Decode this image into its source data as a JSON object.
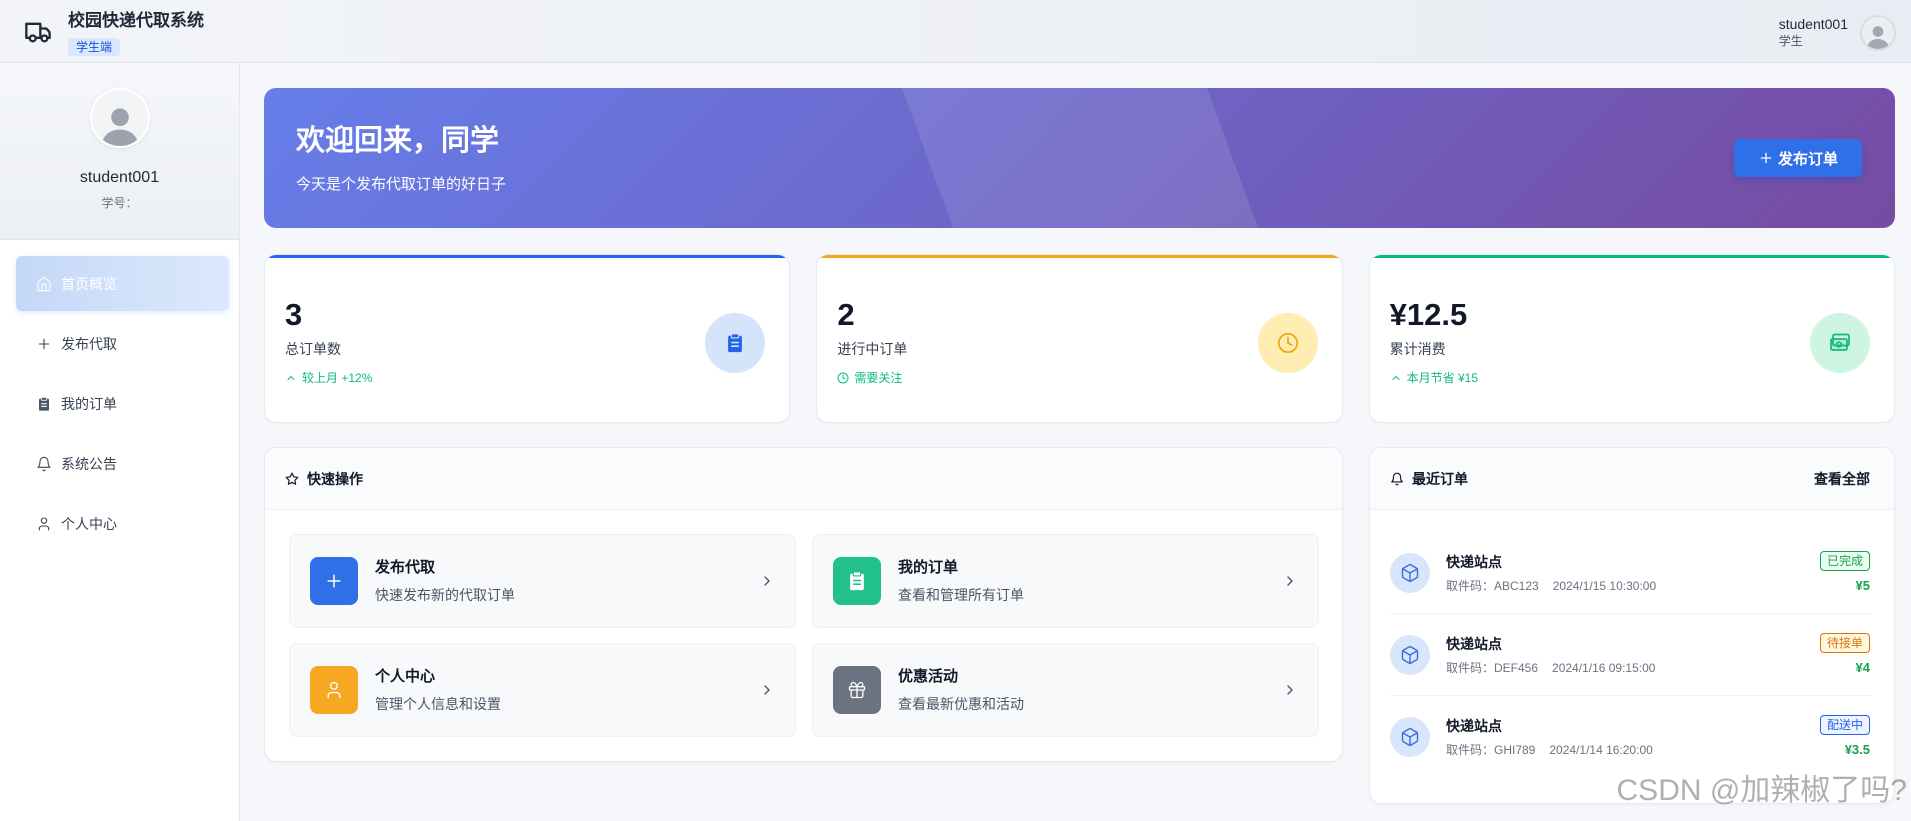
{
  "header": {
    "title": "校园快递代取系统",
    "badge": "学生端",
    "logo_icon": "truck-icon",
    "username": "student001",
    "role": "学生"
  },
  "sidebar": {
    "profile": {
      "name": "student001",
      "student_id_label": "学号："
    },
    "items": [
      {
        "label": "首页概览",
        "icon": "home-icon",
        "active": true
      },
      {
        "label": "发布代取",
        "icon": "plus-icon",
        "active": false
      },
      {
        "label": "我的订单",
        "icon": "clipboard-icon",
        "active": false
      },
      {
        "label": "系统公告",
        "icon": "bell-icon",
        "active": false
      },
      {
        "label": "个人中心",
        "icon": "user-icon",
        "active": false
      }
    ]
  },
  "banner": {
    "title": "欢迎回来，同学",
    "subtitle": "今天是个发布代取订单的好日子",
    "button_label": "发布订单",
    "button_icon": "plus-icon",
    "gradient_start": "#667eea",
    "gradient_end": "#764ba2",
    "button_color": "#2f6fe8"
  },
  "stats": [
    {
      "value": "3",
      "label": "总订单数",
      "trend": "较上月 +12%",
      "trend_icon": "chevron-up-icon",
      "icon": "clipboard-icon",
      "accent": "#2563eb",
      "icon_bg": "#d4e4fb",
      "icon_color": "#2563eb"
    },
    {
      "value": "2",
      "label": "进行中订单",
      "trend": "需要关注",
      "trend_icon": "clock-icon",
      "icon": "clock-icon",
      "accent": "#f5a623",
      "icon_bg": "#feedb0",
      "icon_color": "#f0a30a"
    },
    {
      "value": "¥12.5",
      "label": "累计消费",
      "trend": "本月节省 ¥15",
      "trend_icon": "chevron-up-icon",
      "icon": "banknote-icon",
      "accent": "#10b981",
      "icon_bg": "#cdf5e1",
      "icon_color": "#10b981"
    }
  ],
  "quick_actions": {
    "title": "快速操作",
    "title_icon": "star-icon",
    "items": [
      {
        "title": "发布代取",
        "desc": "快速发布新的代取订单",
        "icon": "plus-icon",
        "color": "#2f6fe8"
      },
      {
        "title": "我的订单",
        "desc": "查看和管理所有订单",
        "icon": "clipboard-icon",
        "color": "#22c08a"
      },
      {
        "title": "个人中心",
        "desc": "管理个人信息和设置",
        "icon": "user-icon",
        "color": "#f6a821"
      },
      {
        "title": "优惠活动",
        "desc": "查看最新优惠和活动",
        "icon": "gift-icon",
        "color": "#6b7280"
      }
    ]
  },
  "recent_orders": {
    "title": "最近订单",
    "title_icon": "bell-icon",
    "view_all": "查看全部",
    "price_color": "#16a34a",
    "items": [
      {
        "title": "快递站点",
        "code": "取件码：ABC123",
        "time": "2024/1/15 10:30:00",
        "status": "已完成",
        "status_color": "#16a34a",
        "status_bg": "#ecfdf3",
        "price": "¥5",
        "icon": "package-icon"
      },
      {
        "title": "快递站点",
        "code": "取件码：DEF456",
        "time": "2024/1/16 09:15:00",
        "status": "待接单",
        "status_color": "#d97706",
        "status_bg": "#fff7e0",
        "price": "¥4",
        "icon": "package-icon"
      },
      {
        "title": "快递站点",
        "code": "取件码：GHI789",
        "time": "2024/1/14 16:20:00",
        "status": "配送中",
        "status_color": "#2563eb",
        "status_bg": "#eef4ff",
        "price": "¥3.5",
        "icon": "package-icon"
      }
    ]
  },
  "watermark": "CSDN @加辣椒了吗?"
}
